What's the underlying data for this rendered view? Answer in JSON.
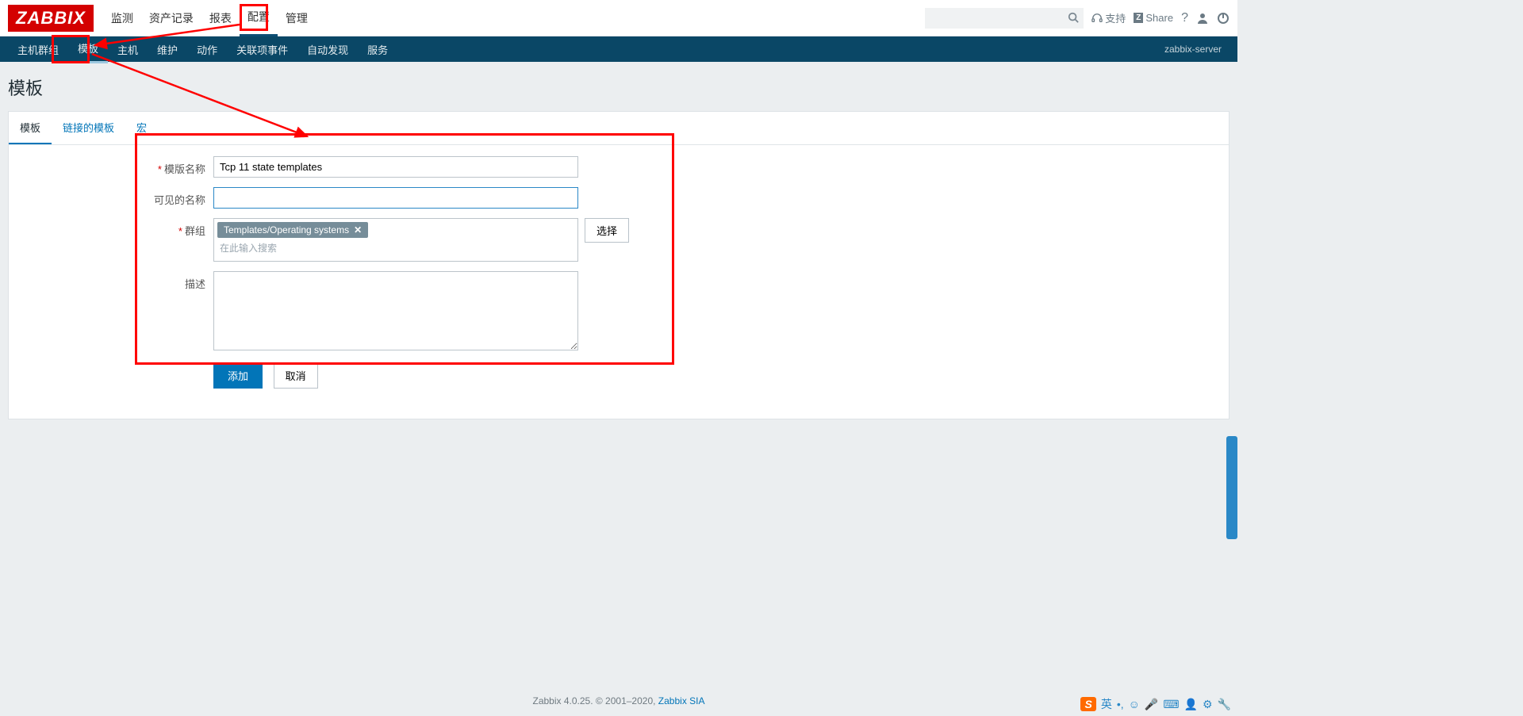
{
  "logo": "ZABBIX",
  "topnav": {
    "items": [
      "监测",
      "资产记录",
      "报表",
      "配置",
      "管理"
    ],
    "activeIndex": 3
  },
  "topright": {
    "support": "支持",
    "share": "Share"
  },
  "subnav": {
    "items": [
      "主机群组",
      "模板",
      "主机",
      "维护",
      "动作",
      "关联项事件",
      "自动发现",
      "服务"
    ],
    "activeIndex": 1,
    "server": "zabbix-server"
  },
  "page_title": "模板",
  "tabs": {
    "items": [
      "模板",
      "链接的模板",
      "宏"
    ],
    "activeIndex": 0
  },
  "form": {
    "name_label": "模版名称",
    "name_value": "Tcp 11 state templates",
    "visible_label": "可见的名称",
    "visible_value": "",
    "group_label": "群组",
    "group_tag": "Templates/Operating systems",
    "group_hint": "在此输入搜索",
    "select_btn": "选择",
    "desc_label": "描述",
    "desc_value": "",
    "add_btn": "添加",
    "cancel_btn": "取消"
  },
  "footer": {
    "text": "Zabbix 4.0.25. © 2001–2020, ",
    "link": "Zabbix SIA"
  },
  "ime": {
    "lang": "英"
  }
}
